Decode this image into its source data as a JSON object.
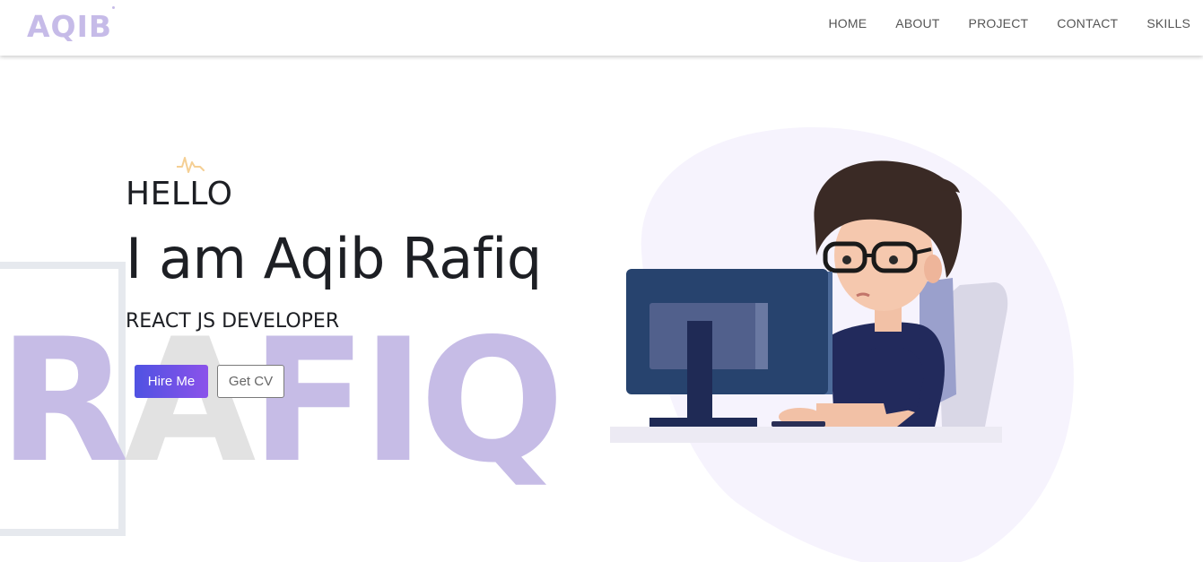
{
  "header": {
    "logo": "AQIB",
    "nav": [
      "HOME",
      "ABOUT",
      "PROJECT",
      "CONTACT",
      "SKILLS"
    ]
  },
  "hero": {
    "greeting": "HELLO",
    "title": "I am Aqib Rafiq",
    "role": "REACT JS DEVELOPER",
    "hire_button": "Hire Me",
    "cv_button": "Get CV",
    "background_word_a": "RAF",
    "background_word_b": "IQ"
  },
  "colors": {
    "brand_lavender": "#c6bbe8",
    "button_gradient_start": "#4f52e2",
    "button_gradient_end": "#8b52ea",
    "text_dark": "#1d1f24"
  },
  "icons": [
    "pulse-icon",
    "developer-illustration"
  ]
}
